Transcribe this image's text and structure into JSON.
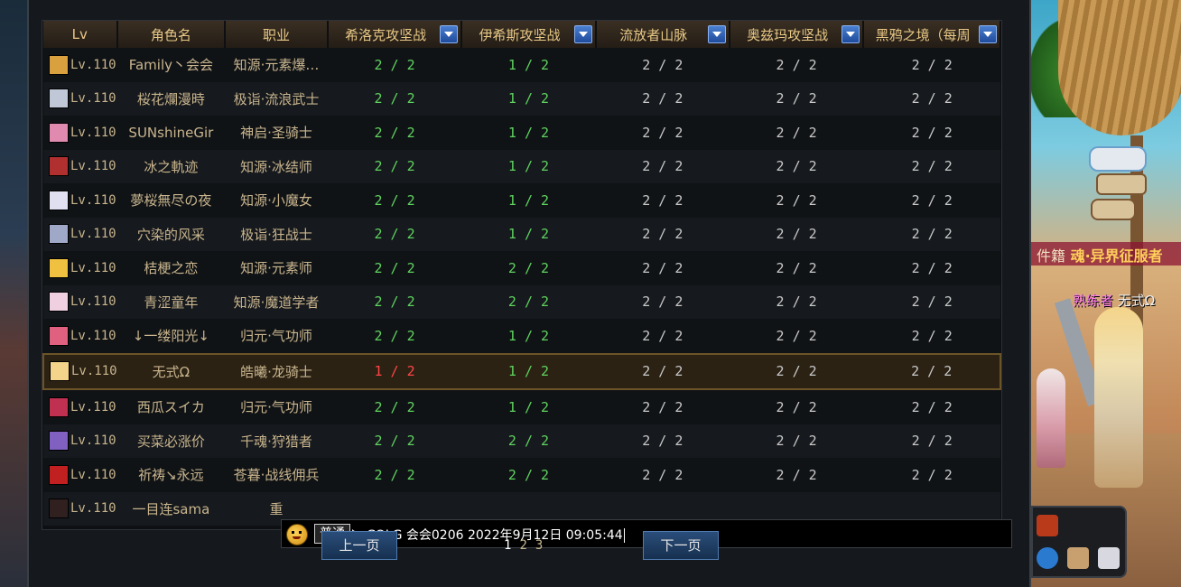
{
  "table": {
    "headers": [
      {
        "label": "Lv",
        "dropdown": false
      },
      {
        "label": "角色名",
        "dropdown": false
      },
      {
        "label": "职业",
        "dropdown": false
      },
      {
        "label": "希洛克攻坚战",
        "dropdown": true
      },
      {
        "label": "伊希斯攻坚战",
        "dropdown": true
      },
      {
        "label": "流放者山脉",
        "dropdown": true
      },
      {
        "label": "奥兹玛攻坚战",
        "dropdown": true
      },
      {
        "label": "黑鸦之境（每周",
        "dropdown": true
      }
    ],
    "rows": [
      {
        "lv": "Lv.110",
        "name": "Family丶会会",
        "job": "知源·元素爆…",
        "v": [
          "2 / 2",
          "1 / 2",
          "2 / 2",
          "2 / 2",
          "2 / 2"
        ],
        "avatar": "#d9a040"
      },
      {
        "lv": "Lv.110",
        "name": "桜花爛漫時",
        "job": "极诣·流浪武士",
        "v": [
          "2 / 2",
          "1 / 2",
          "2 / 2",
          "2 / 2",
          "2 / 2"
        ],
        "avatar": "#c0c8d8"
      },
      {
        "lv": "Lv.110",
        "name": "SUNshineGir",
        "job": "神启·圣骑士",
        "v": [
          "2 / 2",
          "1 / 2",
          "2 / 2",
          "2 / 2",
          "2 / 2"
        ],
        "avatar": "#e08ab0"
      },
      {
        "lv": "Lv.110",
        "name": "冰之軌迹",
        "job": "知源·冰结师",
        "v": [
          "2 / 2",
          "1 / 2",
          "2 / 2",
          "2 / 2",
          "2 / 2"
        ],
        "avatar": "#b03030"
      },
      {
        "lv": "Lv.110",
        "name": "夢桜無尽の夜",
        "job": "知源·小魔女",
        "v": [
          "2 / 2",
          "1 / 2",
          "2 / 2",
          "2 / 2",
          "2 / 2"
        ],
        "avatar": "#e0e0f0"
      },
      {
        "lv": "Lv.110",
        "name": "穴染的风采",
        "job": "极诣·狂战士",
        "v": [
          "2 / 2",
          "1 / 2",
          "2 / 2",
          "2 / 2",
          "2 / 2"
        ],
        "avatar": "#a0a8c8"
      },
      {
        "lv": "Lv.110",
        "name": "桔梗之恋",
        "job": "知源·元素师",
        "v": [
          "2 / 2",
          "2 / 2",
          "2 / 2",
          "2 / 2",
          "2 / 2"
        ],
        "avatar": "#f0c040"
      },
      {
        "lv": "Lv.110",
        "name": "青涩童年",
        "job": "知源·魔道学者",
        "v": [
          "2 / 2",
          "2 / 2",
          "2 / 2",
          "2 / 2",
          "2 / 2"
        ],
        "avatar": "#f0d0e0"
      },
      {
        "lv": "Lv.110",
        "name": "↓一缕阳光↓",
        "job": "归元·气功师",
        "v": [
          "2 / 2",
          "1 / 2",
          "2 / 2",
          "2 / 2",
          "2 / 2"
        ],
        "avatar": "#e06080"
      },
      {
        "lv": "Lv.110",
        "name": "无式Ω",
        "job": "皓曦·龙骑士",
        "v": [
          "1 / 2",
          "1 / 2",
          "2 / 2",
          "2 / 2",
          "2 / 2"
        ],
        "avatar": "#f4d48a",
        "highlight": true
      },
      {
        "lv": "Lv.110",
        "name": "西瓜スイカ",
        "job": "归元·气功师",
        "v": [
          "2 / 2",
          "1 / 2",
          "2 / 2",
          "2 / 2",
          "2 / 2"
        ],
        "avatar": "#c03050"
      },
      {
        "lv": "Lv.110",
        "name": "买菜必涨价",
        "job": "千魂·狩猎者",
        "v": [
          "2 / 2",
          "2 / 2",
          "2 / 2",
          "2 / 2",
          "2 / 2"
        ],
        "avatar": "#8060c0"
      },
      {
        "lv": "Lv.110",
        "name": "祈祷↘永远",
        "job": "苍暮·战线佣兵",
        "v": [
          "2 / 2",
          "2 / 2",
          "2 / 2",
          "2 / 2",
          "2 / 2"
        ],
        "avatar": "#c02020"
      },
      {
        "lv": "Lv.110",
        "name": "一目连sama",
        "job": "重",
        "v": [
          "",
          "",
          "",
          "",
          ""
        ],
        "avatar": "#302020"
      }
    ]
  },
  "chat": {
    "mode": "普通",
    "message": "COLG 会会0206 2022年9月12日 09:05:44"
  },
  "pagination": {
    "prev": "上一页",
    "next": "下一页",
    "pages": [
      "1",
      "2",
      "3"
    ],
    "current": "1"
  },
  "scene": {
    "banner": "魂·异界征服者",
    "side_text": "件籍",
    "player_title": "熟练者",
    "player_name": "无式Ω"
  },
  "colors": {
    "header_text": "#e8c886",
    "cell_text": "#c9b58e",
    "partial": "#5fd35f",
    "full": "#c9c9c9",
    "incomplete": "#ff4545",
    "highlight_border": "#6b5428"
  }
}
